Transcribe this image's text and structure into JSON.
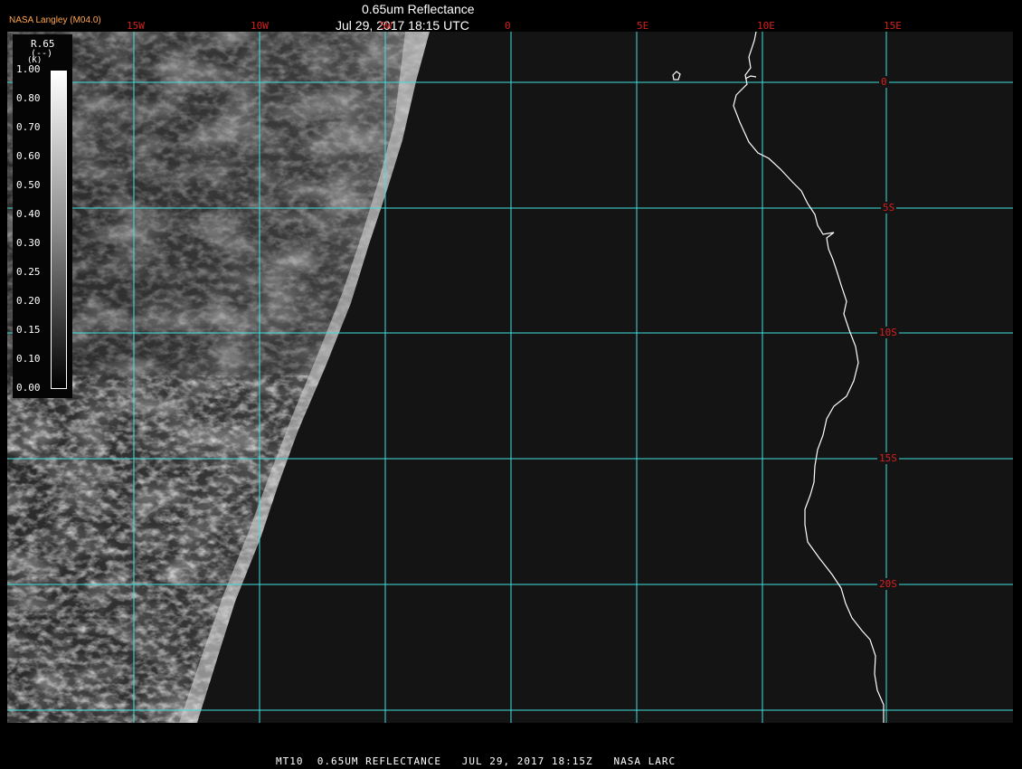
{
  "header": {
    "product": "NASA Langley (M04.0)",
    "title": "0.65um Reflectance",
    "datetime": "Jul 29, 2017 18:15 UTC"
  },
  "map": {
    "grid_color": "#40e0e0",
    "coast_color": "#ffffff",
    "label_color": "#d42020",
    "longitude_labels": [
      "15W",
      "10W",
      "5W",
      "0",
      "5E",
      "10E",
      "15E"
    ],
    "latitude_labels": [
      "0",
      "5S",
      "10S",
      "15S",
      "20S"
    ]
  },
  "legend": {
    "variable": "R.65",
    "units": "(--)",
    "unit_prefix": "(K)",
    "ticks": [
      "1.00",
      "0.80",
      "0.70",
      "0.60",
      "0.50",
      "0.40",
      "0.30",
      "0.25",
      "0.20",
      "0.15",
      "0.10",
      "0.00"
    ]
  },
  "footer": {
    "text": "MT10  0.65UM REFLECTANCE   JUL 29, 2017 18:15Z   NASA LARC"
  }
}
